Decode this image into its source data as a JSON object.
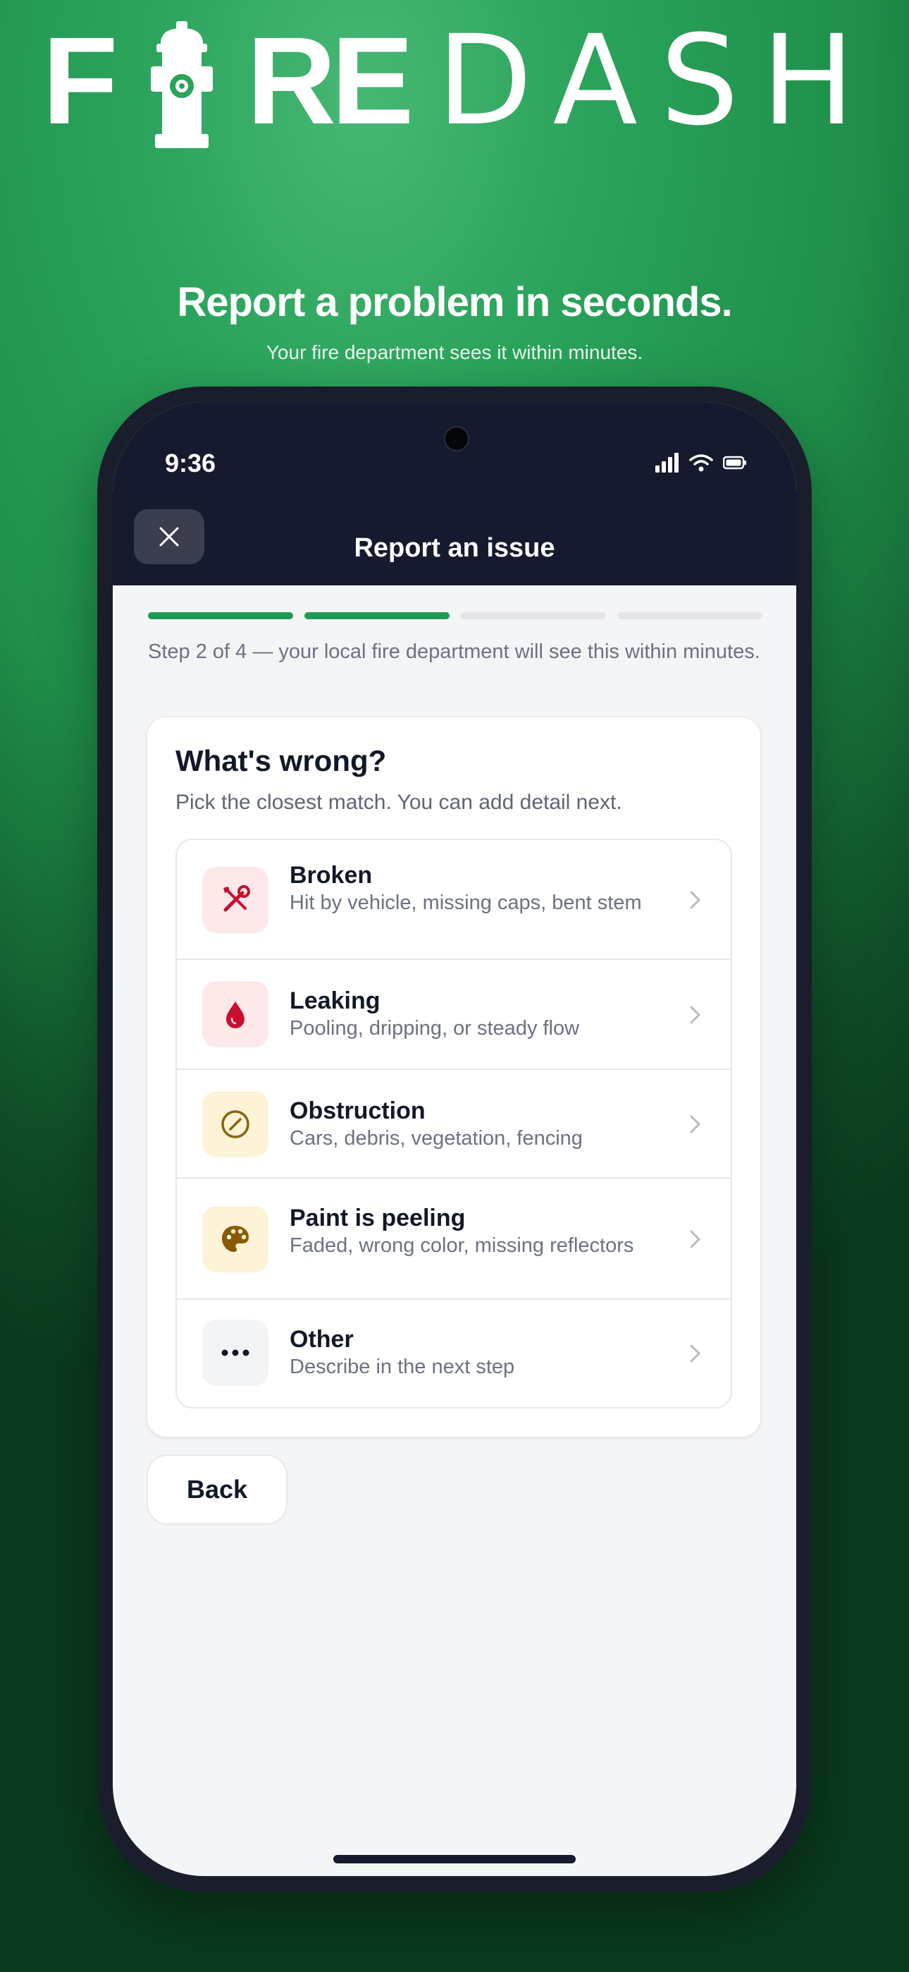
{
  "brand": {
    "letters": [
      "F",
      "R",
      "E"
    ],
    "thin": "DASH",
    "logo_color": "#ffffff",
    "hydrant_accent": "#2aa35b"
  },
  "marketing": {
    "headline": "Report a problem in seconds.",
    "subhead": "Your fire department sees it within minutes."
  },
  "status_bar": {
    "time": "9:36",
    "icons": [
      "signal-icon",
      "wifi-icon",
      "battery-icon"
    ]
  },
  "nav": {
    "title": "Report an issue",
    "close_icon": "close-icon"
  },
  "progress": {
    "total_steps": 4,
    "current_step": 2,
    "text": "Step 2 of 4 — your local fire department will see this within minutes.",
    "active_color": "#1f9a52"
  },
  "card": {
    "title": "What's wrong?",
    "subtitle": "Pick the closest match. You can add detail next."
  },
  "options": [
    {
      "title": "Broken",
      "description": "Hit by vehicle, missing caps, bent stem",
      "icon": "wrench-screwdriver-icon",
      "icon_color": "#c8102e",
      "icon_bg": "#fde8ea"
    },
    {
      "title": "Leaking",
      "description": "Pooling, dripping, or steady flow",
      "icon": "droplet-icon",
      "icon_color": "#c8102e",
      "icon_bg": "#fde8ea"
    },
    {
      "title": "Obstruction",
      "description": "Cars, debris, vegetation, fencing",
      "icon": "prohibited-icon",
      "icon_color": "#8a6410",
      "icon_bg": "#fdf3d7"
    },
    {
      "title": "Paint is peeling",
      "description": "Faded, wrong color, missing reflectors",
      "icon": "palette-icon",
      "icon_color": "#8a5a00",
      "icon_bg": "#fdf3d7"
    },
    {
      "title": "Other",
      "description": "Describe in the next step",
      "icon": "more-icon",
      "icon_color": "#111827",
      "icon_bg": "#f3f4f6"
    }
  ],
  "back_label": "Back"
}
